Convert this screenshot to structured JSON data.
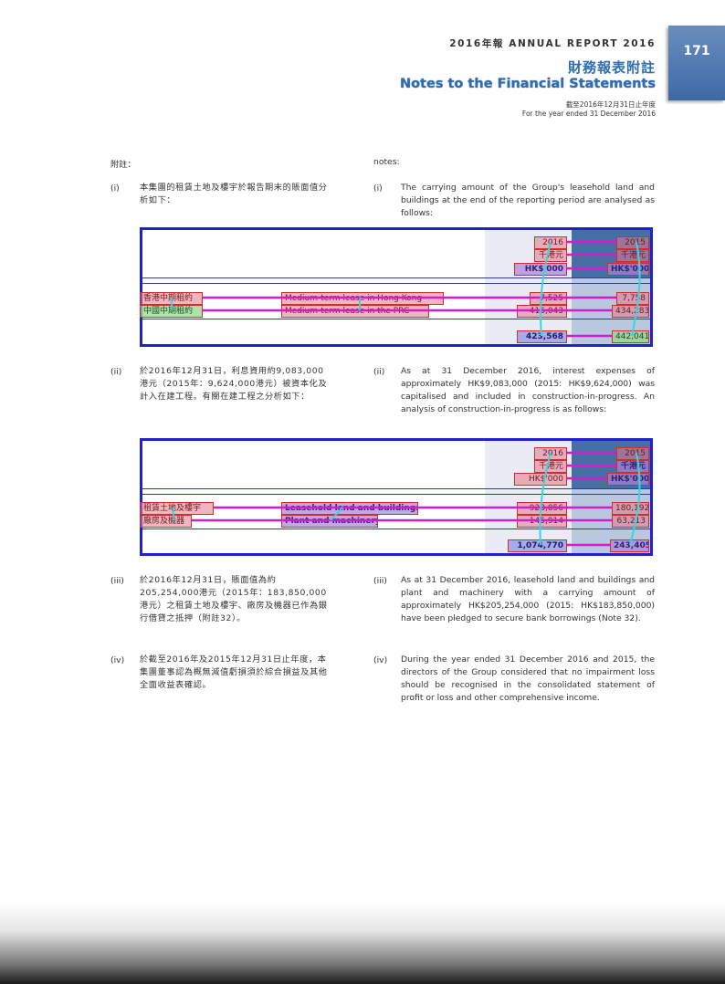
{
  "header": {
    "report": "2016年報 ANNUAL REPORT 2016",
    "page_number": "171",
    "title_zh": "財務報表附註",
    "title_en": "Notes to the Financial Statements",
    "period_zh": "截至2016年12月31日止年度",
    "period_en": "For the year ended 31 December 2016"
  },
  "notes_label_zh": "附註：",
  "notes_label_en": "notes:",
  "note_i": {
    "num": "(i)",
    "zh": "本集團的租賃土地及樓宇於報告期末的賬面值分析如下：",
    "en": "The carrying amount of the Group's leasehold land and buildings at the end of the reporting period are analysed as follows:"
  },
  "table1": {
    "year_2016": "2016",
    "year_2015": "2015",
    "unit_2016": "千港元",
    "unit_2015": "千港元",
    "currency_2016": "HK$'000",
    "currency_2015": "HK$'000",
    "rows": [
      {
        "zh": "香港中期租約",
        "en": "Medium-term lease in Hong Kong",
        "v2016": "7,525",
        "v2015": "7,758"
      },
      {
        "zh": "中國中期租約",
        "en": "Medium-term lease in the PRC",
        "v2016": "416,043",
        "v2015": "434,283"
      }
    ],
    "total_2016": "423,568",
    "total_2015": "442,041"
  },
  "note_ii": {
    "num": "(ii)",
    "zh": "於2016年12月31日，利息資用約9,083,000港元（2015年：9,624,000港元）被資本化及計入在建工程。有關在建工程之分析如下：",
    "en": "As at 31 December 2016, interest expenses of approximately HK$9,083,000 (2015: HK$9,624,000) was capitalised and included in construction-in-progress. An analysis of construction-in-progress is as follows:"
  },
  "table2": {
    "year_2016": "2016",
    "year_2015": "2015",
    "unit_2016": "千港元",
    "unit_2015": "千港元",
    "currency_2016": "HK$'000",
    "currency_2015": "HK$'000",
    "rows": [
      {
        "zh": "租賃土地及樓宇",
        "en": "Leasehold land and buildings",
        "v2016": "928,856",
        "v2015": "180,192"
      },
      {
        "zh": "廠房及機器",
        "en": "Plant and machinery",
        "v2016": "145,914",
        "v2015": "63,213"
      }
    ],
    "total_2016": "1,074,770",
    "total_2015": "243,405"
  },
  "note_iii": {
    "num": "(iii)",
    "zh": "於2016年12月31日，賬面值為約205,254,000港元（2015年：183,850,000港元）之租賃土地及樓宇、廠房及機器已作為銀行借貸之抵押（附註32）。",
    "en": "As at 31 December 2016, leasehold land and buildings and plant and machinery with a carrying amount of approximately HK$205,254,000 (2015: HK$183,850,000) have been pledged to secure bank borrowings (Note 32)."
  },
  "note_iv": {
    "num": "(iv)",
    "zh": "於截至2016年及2015年12月31日止年度，本集團董事認為概無減值虧損須於綜合損益及其他全面收益表確認。",
    "en": "During the year ended 31 December 2016 and 2015, the directors of the Group considered that no impairment loss should be recognised in the consolidated statement of profit or loss and other comprehensive income."
  },
  "colors": {
    "accent": "#2d6db0",
    "table_border": "#1e22c8",
    "connector": "#d41ccf"
  }
}
